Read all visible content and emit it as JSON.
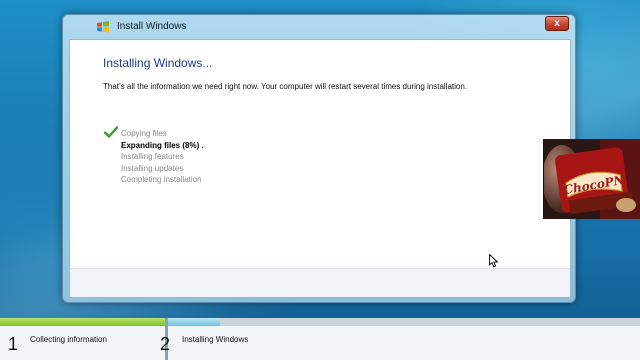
{
  "window": {
    "title": "Install Windows",
    "close_glyph": "x",
    "close_color": "#c4432f",
    "heading": "Installing Windows...",
    "message": "That’s all the information we need right now. Your computer will restart several times during installation."
  },
  "steps": [
    {
      "label": "Copying files",
      "status": "done",
      "icon": "check-icon"
    },
    {
      "label": "Expanding files (8%) .",
      "status": "active"
    },
    {
      "label": "Installing features",
      "status": "pending"
    },
    {
      "label": "Installing updates",
      "status": "pending"
    },
    {
      "label": "Completing installation",
      "status": "pending"
    }
  ],
  "expanding_progress_percent": 8,
  "pip": {
    "brand_text": "ChocoPN"
  },
  "taskbar": {
    "accent": "#7fbf2b",
    "stages": [
      {
        "number": "1",
        "label": "Collecting information",
        "state": "complete"
      },
      {
        "number": "2",
        "label": "Installing Windows",
        "state": "in-progress"
      }
    ]
  }
}
